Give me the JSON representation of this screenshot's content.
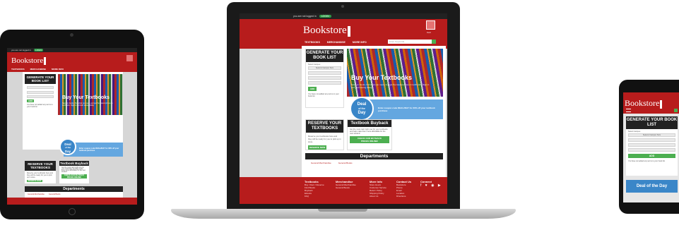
{
  "site": {
    "logo": "Bookstore",
    "top_promo": "you are not logged in",
    "top_btn": "LOGIN",
    "search_placeholder": "Enter Keywords",
    "cart_label": "Cart",
    "nav": [
      "TEXTBOOKS",
      "MERCHANDISE",
      "MORE INFO"
    ]
  },
  "booklist": {
    "title_line1": "GENERATE YOUR",
    "title_line2": "BOOK LIST",
    "select_label": "Select Campus:",
    "select_value": "Select A Campus Term",
    "add_btn": "ADD",
    "note": "You have not added any terms to your book list"
  },
  "hero": {
    "title": "Buy Your Textbooks",
    "subtitle": "Save on books, find what you need, and get the lowest prices on textbooks. Sign in and start saving today."
  },
  "deal": {
    "line1": "Deal",
    "line2": "of the",
    "line3": "Day",
    "text": "Enter coupon code DEAL2DAY for 30% off your textbook purchase",
    "mobile_label": "Deal of the Day"
  },
  "reserve": {
    "title_line1": "RESERVE YOUR",
    "title_line2": "TEXTBOOKS",
    "body": "Reserve your textbooks here and they will be ready for you to pick up in store.",
    "btn": "RESERVE NOW"
  },
  "buyback": {
    "title": "Textbook Buyback",
    "body": "Get the most cash right now for your textbooks and help make them more affordable for the next student!",
    "btn_line1": "CHECK OUR BUYBACK",
    "btn_line2": "PRICES ONLINE!"
  },
  "departments": {
    "title": "Departments",
    "items": [
      "General Merchandise",
      "General Books"
    ]
  },
  "footer": {
    "cols": [
      {
        "head": "Textbooks",
        "items": [
          "Buy / Rent / Reserve",
          "Find Books",
          "Buyback",
          "Ebooks",
          "FAQ"
        ]
      },
      {
        "head": "Merchandise",
        "items": [
          "General Merchandise",
          "General Books"
        ]
      },
      {
        "head": "More Info",
        "items": [
          "Store Hours",
          "Customer Service",
          "Return Policy",
          "Shipping Policy",
          "About Us"
        ]
      },
      {
        "head": "Contact Us",
        "items": [
          "Bookstore",
          "Phone",
          "Email",
          "Location",
          "Directions"
        ]
      },
      {
        "head": "Connect",
        "items": []
      }
    ]
  },
  "mobile": {
    "title_line1": "GENERATE YOUR BOOK",
    "title_line2": "LIST",
    "note": "You have not added any terms to your book list"
  },
  "colors": {
    "brand_red": "#b71c1c",
    "green": "#4caf50",
    "deal_blue": "#64a7e0",
    "dark": "#222222"
  }
}
